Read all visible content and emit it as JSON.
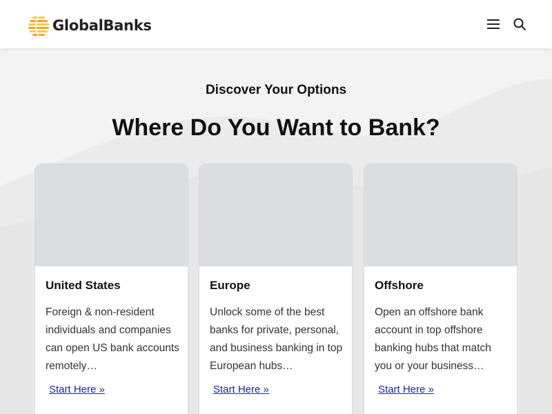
{
  "header": {
    "brand": "GlobalBanks",
    "logo_colors": [
      "#f5a623",
      "#f7c948"
    ],
    "menu_icon": "hamburger-menu-icon",
    "search_icon": "search-icon"
  },
  "section": {
    "eyebrow": "Discover Your Options",
    "heading": "Where Do You Want to Bank?"
  },
  "cards": [
    {
      "title": "United States",
      "text": "Foreign & non-resident individuals and companies can open US bank accounts remotely…",
      "link": "Start Here »"
    },
    {
      "title": "Europe",
      "text": "Unlock some of the best banks for private, personal, and business banking in top European hubs…",
      "link": "Start Here »"
    },
    {
      "title": "Offshore",
      "text": "Open an offshore bank account in top offshore banking hubs that match you or your business…",
      "link": "Start Here »"
    }
  ],
  "colors": {
    "link": "#1a2b8c",
    "background": "#f3f3f3",
    "card_image_placeholder": "#dcdde1"
  }
}
